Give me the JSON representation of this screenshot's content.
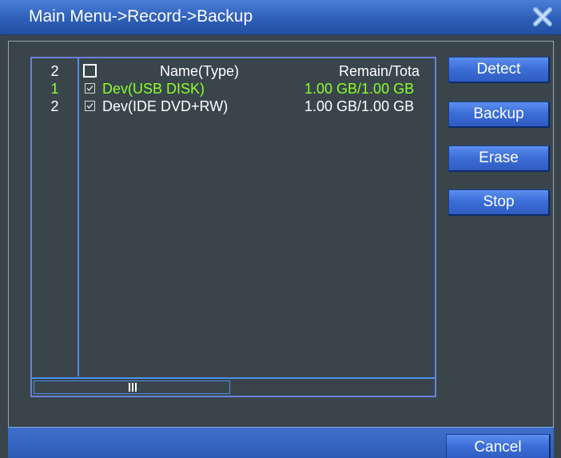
{
  "window": {
    "title": "Main Menu->Record->Backup",
    "close_icon": "close-icon",
    "title_color": "#ffffff"
  },
  "device_list": {
    "columns": {
      "count": "2",
      "select_all_checkbox": false,
      "name": "Name(Type)",
      "remain": "Remain/Tota"
    },
    "rows": [
      {
        "index": "1",
        "checked": true,
        "name": "Dev(USB DISK)",
        "remain": "1.00 GB/1.00 GB",
        "selected": true,
        "color": "#8cff2a"
      },
      {
        "index": "2",
        "checked": true,
        "name": "Dev(IDE DVD+RW)",
        "remain": "1.00 GB/1.00 GB",
        "selected": false,
        "color": "#ffffff"
      }
    ],
    "scrollbar_icon": "scroll-grip-icon"
  },
  "actions": {
    "detect": "Detect",
    "backup": "Backup",
    "erase": "Erase",
    "stop": "Stop"
  },
  "footer": {
    "cancel": "Cancel"
  },
  "colors": {
    "background": "#39454b",
    "accent_blue": "#3c6fd8",
    "selected_text": "#8cff2a",
    "list_border": "#6e7fd9"
  }
}
